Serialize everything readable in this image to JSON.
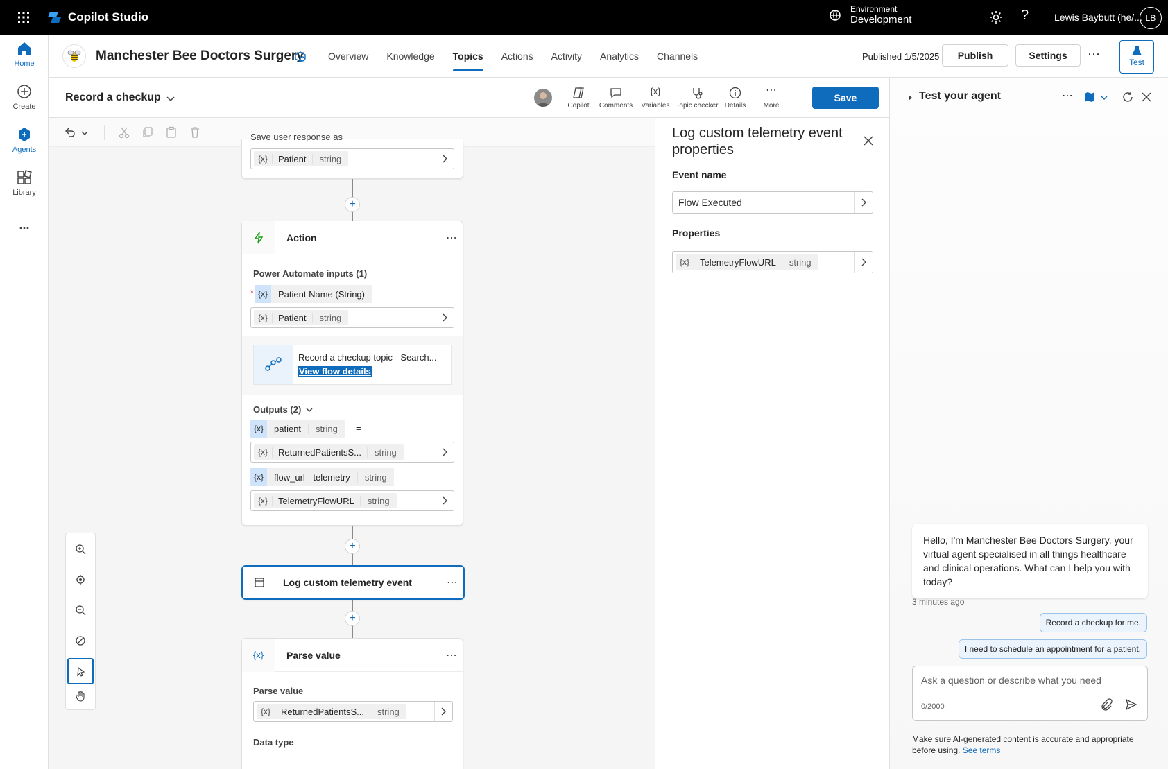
{
  "app": {
    "name": "Copilot Studio"
  },
  "environment": {
    "label": "Environment",
    "value": "Development"
  },
  "user": {
    "name": "Lewis Baybutt (he/...",
    "initials": "LB"
  },
  "rail": [
    {
      "label": "Home"
    },
    {
      "label": "Create"
    },
    {
      "label": "Agents"
    },
    {
      "label": "Library"
    },
    {
      "label": "..."
    }
  ],
  "agent": {
    "title": "Manchester Bee Doctors Surgery",
    "published": "Published 1/5/2025",
    "publish_label": "Publish",
    "settings_label": "Settings",
    "test_label": "Test"
  },
  "nav": [
    {
      "label": "Overview"
    },
    {
      "label": "Knowledge"
    },
    {
      "label": "Topics"
    },
    {
      "label": "Actions"
    },
    {
      "label": "Activity"
    },
    {
      "label": "Analytics"
    },
    {
      "label": "Channels"
    }
  ],
  "topic": {
    "name": "Record a checkup",
    "tools": [
      {
        "label": "Copilot"
      },
      {
        "label": "Comments"
      },
      {
        "label": "Variables"
      },
      {
        "label": "Topic checker"
      },
      {
        "label": "Details"
      },
      {
        "label": "More"
      }
    ],
    "save_label": "Save"
  },
  "canvas": {
    "save_response_label": "Save user response as",
    "save_response_var": {
      "name": "Patient",
      "type": "string"
    },
    "action_node": {
      "title": "Action",
      "inputs_label": "Power Automate inputs (1)",
      "input_param": "Patient Name (String)",
      "input_var": {
        "name": "Patient",
        "type": "string"
      },
      "flow_name": "Record a checkup topic - Search...",
      "flow_link": "View flow details",
      "outputs_label": "Outputs (2)",
      "outputs": [
        {
          "param": "patient",
          "param_type": "string",
          "var": "ReturnedPatientsS...",
          "var_type": "string"
        },
        {
          "param": "flow_url - telemetry",
          "param_type": "string",
          "var": "TelemetryFlowURL",
          "var_type": "string"
        }
      ]
    },
    "telemetry_node": {
      "title": "Log custom telemetry event"
    },
    "parse_node": {
      "title": "Parse value",
      "section_label": "Parse value",
      "var": {
        "name": "ReturnedPatientsS...",
        "type": "string"
      },
      "data_type_label": "Data type"
    },
    "var_glyph": "{x}",
    "equals": "="
  },
  "properties": {
    "title": "Log custom telemetry event properties",
    "event_name_label": "Event name",
    "event_name_value": "Flow Executed",
    "properties_label": "Properties",
    "properties_var": {
      "name": "TelemetryFlowURL",
      "type": "string"
    }
  },
  "test_panel": {
    "title": "Test your agent",
    "bot_message": "Hello, I'm Manchester Bee Doctors Surgery, your virtual agent specialised in all things healthcare and clinical operations. What can I help you with today?",
    "timestamp": "3 minutes ago",
    "user_messages": [
      "Record a checkup for me.",
      "I need to schedule an appointment for a patient."
    ],
    "input_placeholder": "Ask a question or describe what you need",
    "char_count": "0/2000",
    "disclaimer": "Make sure AI-generated content is accurate and appropriate before using.",
    "disclaimer_link": "See terms"
  },
  "colors": {
    "accent": "#0f6cbd",
    "topbar": "#000000",
    "var_tag_blue": "#cfe4fa"
  }
}
